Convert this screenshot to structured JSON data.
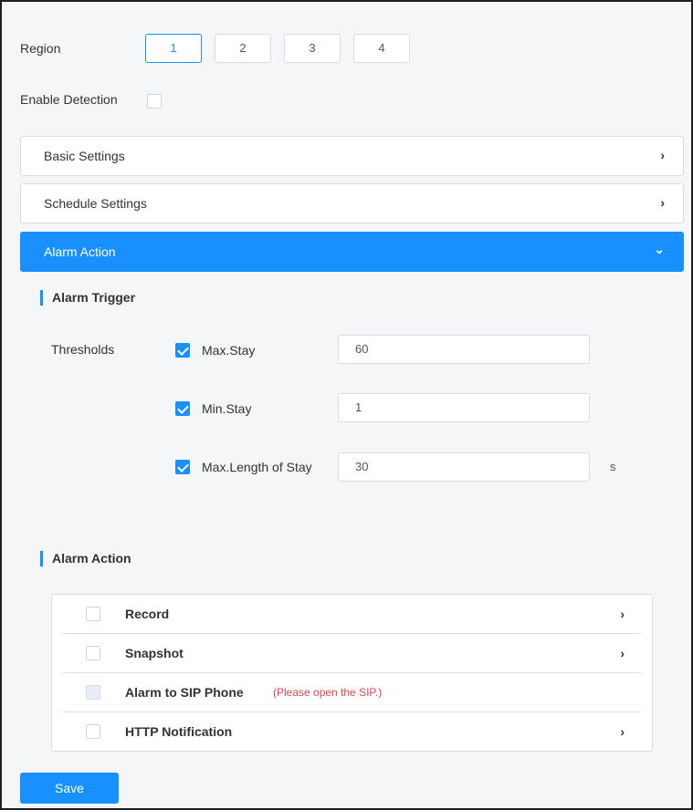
{
  "region": {
    "label": "Region",
    "buttons": [
      "1",
      "2",
      "3",
      "4"
    ],
    "active": "1"
  },
  "enable_detection": {
    "label": "Enable Detection",
    "checked": false
  },
  "panels": {
    "basic": {
      "title": "Basic Settings",
      "icon": "chevron-right-icon"
    },
    "schedule": {
      "title": "Schedule Settings",
      "icon": "chevron-right-icon"
    },
    "alarm": {
      "title": "Alarm Action",
      "icon": "chevron-down-icon",
      "expanded": true
    }
  },
  "alarm_trigger": {
    "title": "Alarm Trigger",
    "thresholds_label": "Thresholds",
    "items": [
      {
        "label": "Max.Stay",
        "checked": true,
        "value": "60",
        "unit": ""
      },
      {
        "label": "Min.Stay",
        "checked": true,
        "value": "1",
        "unit": ""
      },
      {
        "label": "Max.Length of Stay",
        "checked": true,
        "value": "30",
        "unit": "s"
      }
    ]
  },
  "alarm_action": {
    "title": "Alarm Action",
    "rows": [
      {
        "label": "Record",
        "checked": false,
        "has_chevron": true
      },
      {
        "label": "Snapshot",
        "checked": false,
        "has_chevron": true
      },
      {
        "label": "Alarm to SIP Phone",
        "checked": false,
        "disabled": true,
        "note": "(Please open the SIP.)"
      },
      {
        "label": "HTTP Notification",
        "checked": false,
        "has_chevron": true
      }
    ]
  },
  "save_label": "Save",
  "colors": {
    "accent": "#1890ff",
    "warning_text": "#e0454b",
    "background": "#f5f6f8"
  }
}
